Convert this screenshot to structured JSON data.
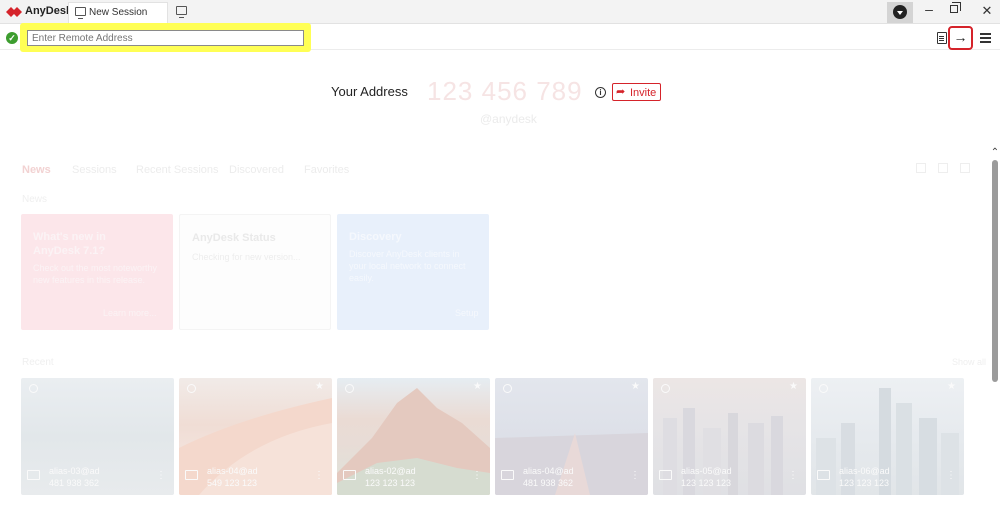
{
  "window": {
    "app_name": "AnyDesk",
    "tab_label": "New Session",
    "minimize_glyph": "–",
    "close_glyph": "✕"
  },
  "toolbar": {
    "status_glyph": "✓",
    "address_placeholder": "Enter Remote Address",
    "connect_glyph": "→",
    "highlight_color": "#ffff55",
    "accent_color": "#d5232a"
  },
  "identity": {
    "your_address_label": "Your Address",
    "address_number": "123 456 789",
    "alias": "@anydesk",
    "info_glyph": "i",
    "invite_label": "Invite",
    "invite_glyph": "➦"
  },
  "sections": {
    "tabs": [
      "News",
      "Sessions",
      "Recent Sessions",
      "Discovered",
      "Favorites"
    ],
    "news_label": "News",
    "recent_label": "Recent",
    "show_all_label": "Show all"
  },
  "cards": [
    {
      "title": "What's new in\nAnyDesk 7.1?",
      "text": "Check out the most noteworthy new features in this release.",
      "link": "Learn more..."
    },
    {
      "title": "AnyDesk Status",
      "text": "Checking for new version...",
      "link": ""
    },
    {
      "title": "Discovery",
      "text": "Discover AnyDesk clients in your local network to connect easily.",
      "link": "Setup"
    }
  ],
  "sessions": [
    {
      "alias": "alias-03@ad",
      "id": "481 938 362"
    },
    {
      "alias": "alias-04@ad",
      "id": "549 123 123"
    },
    {
      "alias": "alias-02@ad",
      "id": "123 123 123"
    },
    {
      "alias": "alias-04@ad",
      "id": "481 938 362"
    },
    {
      "alias": "alias-05@ad",
      "id": "123 123 123"
    },
    {
      "alias": "alias-06@ad",
      "id": "123 123 123"
    }
  ],
  "icons": {
    "logo": "anydesk-logo-icon",
    "star": "★",
    "more": "⋮",
    "scroll_up": "⌃"
  }
}
